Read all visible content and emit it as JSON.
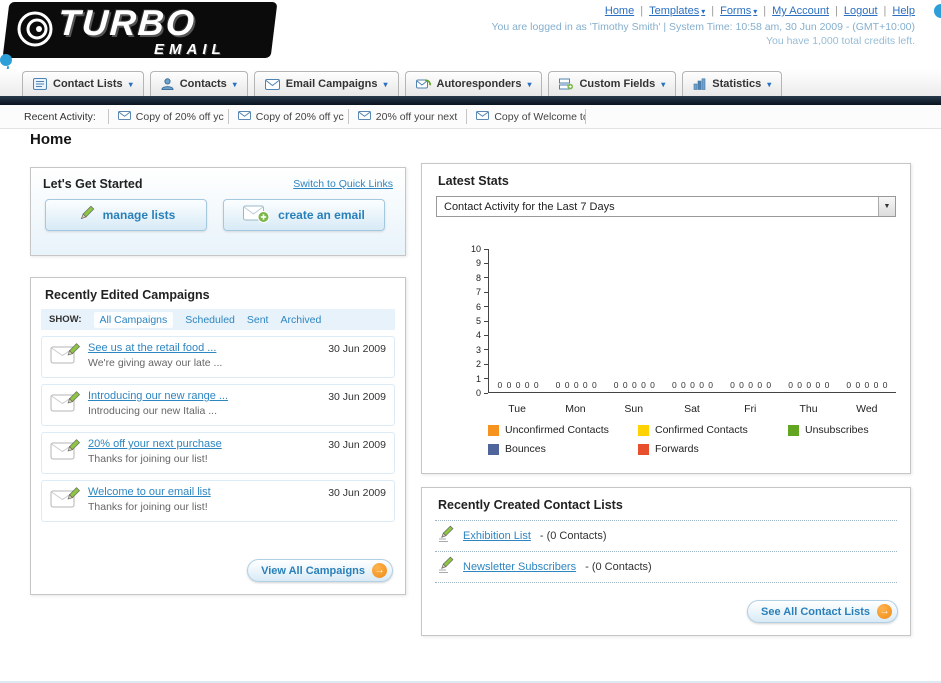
{
  "ui": {
    "sep": "|",
    "caret_down": "▾",
    "select_caret": "▼",
    "arrow_icon": "→"
  },
  "header": {
    "logo": {
      "turbo": "TURBO",
      "email": "EMAIL"
    },
    "nav": {
      "home": "Home",
      "templates": "Templates",
      "forms": "Forms",
      "my_account": "My Account",
      "logout": "Logout",
      "help": "Help"
    },
    "login_info": "You are logged in as 'Timothy Smith' | System Time: 10:58 am, 30 Jun 2009 - (GMT+10:00)",
    "credits_info": "You have 1,000 total credits left."
  },
  "tabs": [
    {
      "label": "Contact Lists",
      "icon": "contact-lists-icon"
    },
    {
      "label": "Contacts",
      "icon": "contacts-icon"
    },
    {
      "label": "Email Campaigns",
      "icon": "email-campaigns-icon"
    },
    {
      "label": "Autoresponders",
      "icon": "autoresponders-icon"
    },
    {
      "label": "Custom Fields",
      "icon": "custom-fields-icon"
    },
    {
      "label": "Statistics",
      "icon": "statistics-icon"
    }
  ],
  "recent_activity": {
    "label": "Recent Activity:",
    "items": [
      "Copy of 20% off yc",
      "Copy of 20% off yc",
      "20% off your next",
      "Copy of Welcome tc"
    ]
  },
  "page_title": "Home",
  "get_started": {
    "title": "Let's Get Started",
    "switch_link": "Switch to Quick Links",
    "manage_lists": "manage lists",
    "create_email": "create an email"
  },
  "campaigns": {
    "title": "Recently Edited Campaigns",
    "show_label": "SHOW:",
    "tabs": [
      "All Campaigns",
      "Scheduled",
      "Sent",
      "Archived"
    ],
    "items": [
      {
        "title": "See us at the retail food ...",
        "subtitle": "We're giving away our late ...",
        "date": "30 Jun 2009"
      },
      {
        "title": "Introducing our new range ...",
        "subtitle": "Introducing our new Italia ...",
        "date": "30 Jun 2009"
      },
      {
        "title": "20% off your next purchase",
        "subtitle": "Thanks for joining our list!",
        "date": "30 Jun 2009"
      },
      {
        "title": "Welcome to our email list",
        "subtitle": "Thanks for joining our list!",
        "date": "30 Jun 2009"
      }
    ],
    "view_all_label": "View All Campaigns"
  },
  "stats": {
    "title": "Latest Stats",
    "selected_option": "Contact Activity for the Last 7 Days"
  },
  "chart_data": {
    "type": "bar",
    "title": "Contact Activity for the Last 7 Days",
    "categories": [
      "Tue",
      "Mon",
      "Sun",
      "Sat",
      "Fri",
      "Thu",
      "Wed"
    ],
    "series": [
      {
        "name": "Unconfirmed Contacts",
        "color": "#f6921e",
        "values": [
          0,
          0,
          0,
          0,
          0,
          0,
          0
        ]
      },
      {
        "name": "Confirmed Contacts",
        "color": "#ffd200",
        "values": [
          0,
          0,
          0,
          0,
          0,
          0,
          0
        ]
      },
      {
        "name": "Unsubscribes",
        "color": "#61a521",
        "values": [
          0,
          0,
          0,
          0,
          0,
          0,
          0
        ]
      },
      {
        "name": "Bounces",
        "color": "#50659b",
        "values": [
          0,
          0,
          0,
          0,
          0,
          0,
          0
        ]
      },
      {
        "name": "Forwards",
        "color": "#e8502d",
        "values": [
          0,
          0,
          0,
          0,
          0,
          0,
          0
        ]
      }
    ],
    "ylim": [
      0,
      10
    ],
    "yticks": [
      0,
      1,
      2,
      3,
      4,
      5,
      6,
      7,
      8,
      9,
      10
    ],
    "grid": false,
    "legend_position": "bottom",
    "bar_value_labels": true
  },
  "contact_lists": {
    "title": "Recently Created Contact Lists",
    "items": [
      {
        "name": "Exhibition List",
        "suffix": "- (0 Contacts)"
      },
      {
        "name": "Newsletter Subscribers",
        "suffix": "- (0 Contacts)"
      }
    ],
    "see_all_label": "See All Contact Lists"
  }
}
